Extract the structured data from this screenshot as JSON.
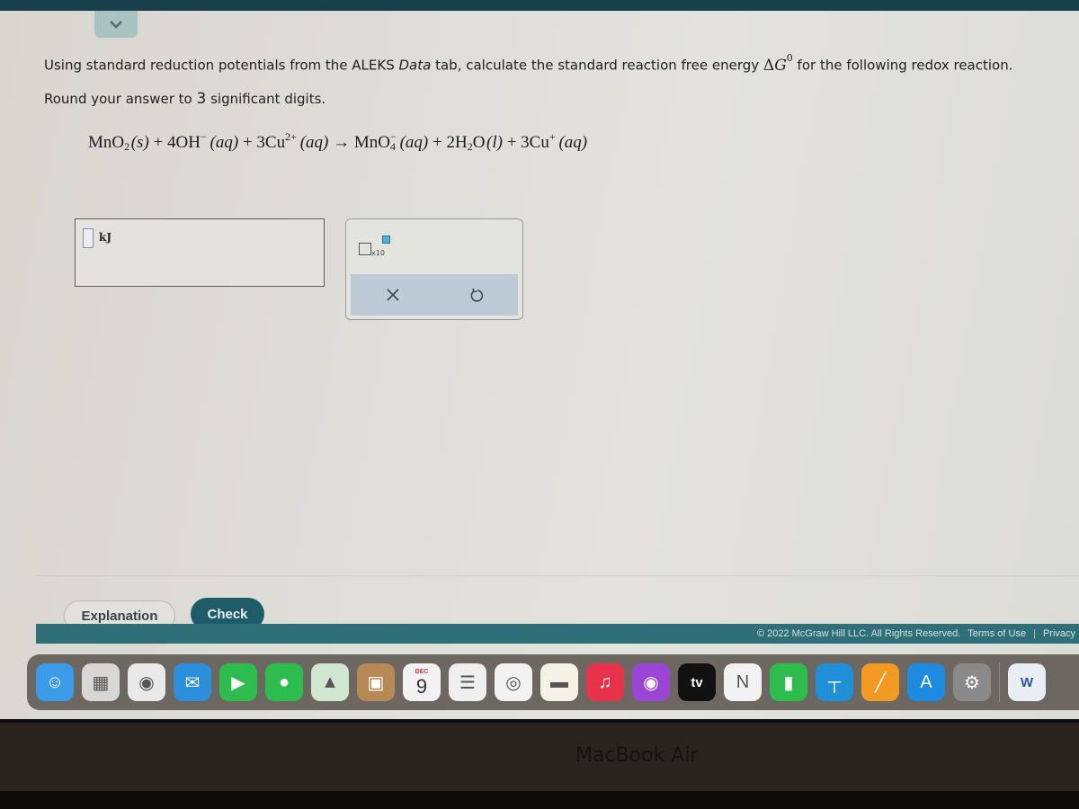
{
  "page": {
    "question": {
      "prefix": "Using standard reduction potentials from the ALEKS ",
      "data_word": "Data",
      "middle": " tab, calculate the standard reaction free energy ",
      "delta_symbol": "Δ",
      "g_symbol": "G",
      "g_superscript": "0",
      "suffix": " for the following redox reaction."
    },
    "round_instruction": {
      "before": "Round your answer to ",
      "number": "3",
      "after": " significant digits."
    },
    "equation": {
      "r1": "MnO",
      "r1_sub": "2",
      "r1_state": "(s)",
      "plus1": " + ",
      "r2": "4OH",
      "r2_sup": "−",
      "r2_state": "(aq)",
      "plus2": " + ",
      "r3": "3Cu",
      "r3_sup": "2+",
      "r3_state": "(aq)",
      "arrow": "→",
      "p1": "MnO",
      "p1_sub": "4",
      "p1_sup": "−",
      "p1_state": "(aq)",
      "plus3": " + ",
      "p2": "2H",
      "p2_sub": "2",
      "p2_tail": "O",
      "p2_state": "(l)",
      "plus4": " + ",
      "p3": "3Cu",
      "p3_sup": "+",
      "p3_state": "(aq)"
    },
    "answer": {
      "value": "",
      "unit": "kJ"
    },
    "keypad": {
      "sci_label": "x10",
      "clear_icon": "x-icon",
      "undo_icon": "undo-icon"
    },
    "buttons": {
      "explanation": "Explanation",
      "check": "Check"
    },
    "footer": {
      "copyright": "© 2022 McGraw Hill LLC. All Rights Reserved.",
      "terms": "Terms of Use",
      "separator": "|",
      "privacy": "Privacy"
    }
  },
  "dock": {
    "items": [
      {
        "name": "Finder",
        "icon": "finder-icon",
        "color": "#3a9be8"
      },
      {
        "name": "Launchpad",
        "icon": "launchpad-icon",
        "color": "#d9d7d5"
      },
      {
        "name": "Safari",
        "icon": "safari-icon",
        "color": "#e9e9e9"
      },
      {
        "name": "Mail",
        "icon": "mail-icon",
        "color": "#2c8fdc"
      },
      {
        "name": "FaceTime",
        "icon": "facetime-icon",
        "color": "#2dbd4d"
      },
      {
        "name": "Messages",
        "icon": "messages-icon",
        "color": "#2dbd4d"
      },
      {
        "name": "Maps",
        "icon": "maps-icon",
        "color": "#cfe7d0"
      },
      {
        "name": "Contacts",
        "icon": "contacts-icon",
        "color": "#b78a55"
      },
      {
        "name": "Calendar",
        "icon": "calendar-icon",
        "color": "#f2f2f2",
        "month": "DEC",
        "day": "9"
      },
      {
        "name": "Reminders",
        "icon": "reminders-icon",
        "color": "#efefef"
      },
      {
        "name": "Chrome",
        "icon": "chrome-icon",
        "color": "#f2f2f2"
      },
      {
        "name": "Notes",
        "icon": "notes-icon",
        "color": "#f4f2e6"
      },
      {
        "name": "Music",
        "icon": "music-icon",
        "color": "#e8324a"
      },
      {
        "name": "Podcasts",
        "icon": "podcasts-icon",
        "color": "#9b45d6"
      },
      {
        "name": "TV",
        "icon": "tv-icon",
        "color": "#111111",
        "label": "tv"
      },
      {
        "name": "News",
        "icon": "news-icon",
        "color": "#f2f2f2"
      },
      {
        "name": "Numbers",
        "icon": "numbers-icon",
        "color": "#2dbd4d"
      },
      {
        "name": "Keynote",
        "icon": "keynote-icon",
        "color": "#1f8fd8"
      },
      {
        "name": "Pages",
        "icon": "pages-icon",
        "color": "#f39a22"
      },
      {
        "name": "App Store",
        "icon": "app-store-icon",
        "color": "#1d8ce0"
      },
      {
        "name": "System Preferences",
        "icon": "system-preferences-icon",
        "color": "#8a8a8a"
      },
      {
        "name": "Microsoft Word",
        "icon": "word-icon",
        "color": "#e9eef5",
        "label": "W"
      }
    ]
  },
  "device": {
    "label": "MacBook Air"
  },
  "colors": {
    "accent": "#1e5d67",
    "footer": "#2f6f78",
    "topbar": "#17404a",
    "exponent_box": "#4fb3d9"
  }
}
